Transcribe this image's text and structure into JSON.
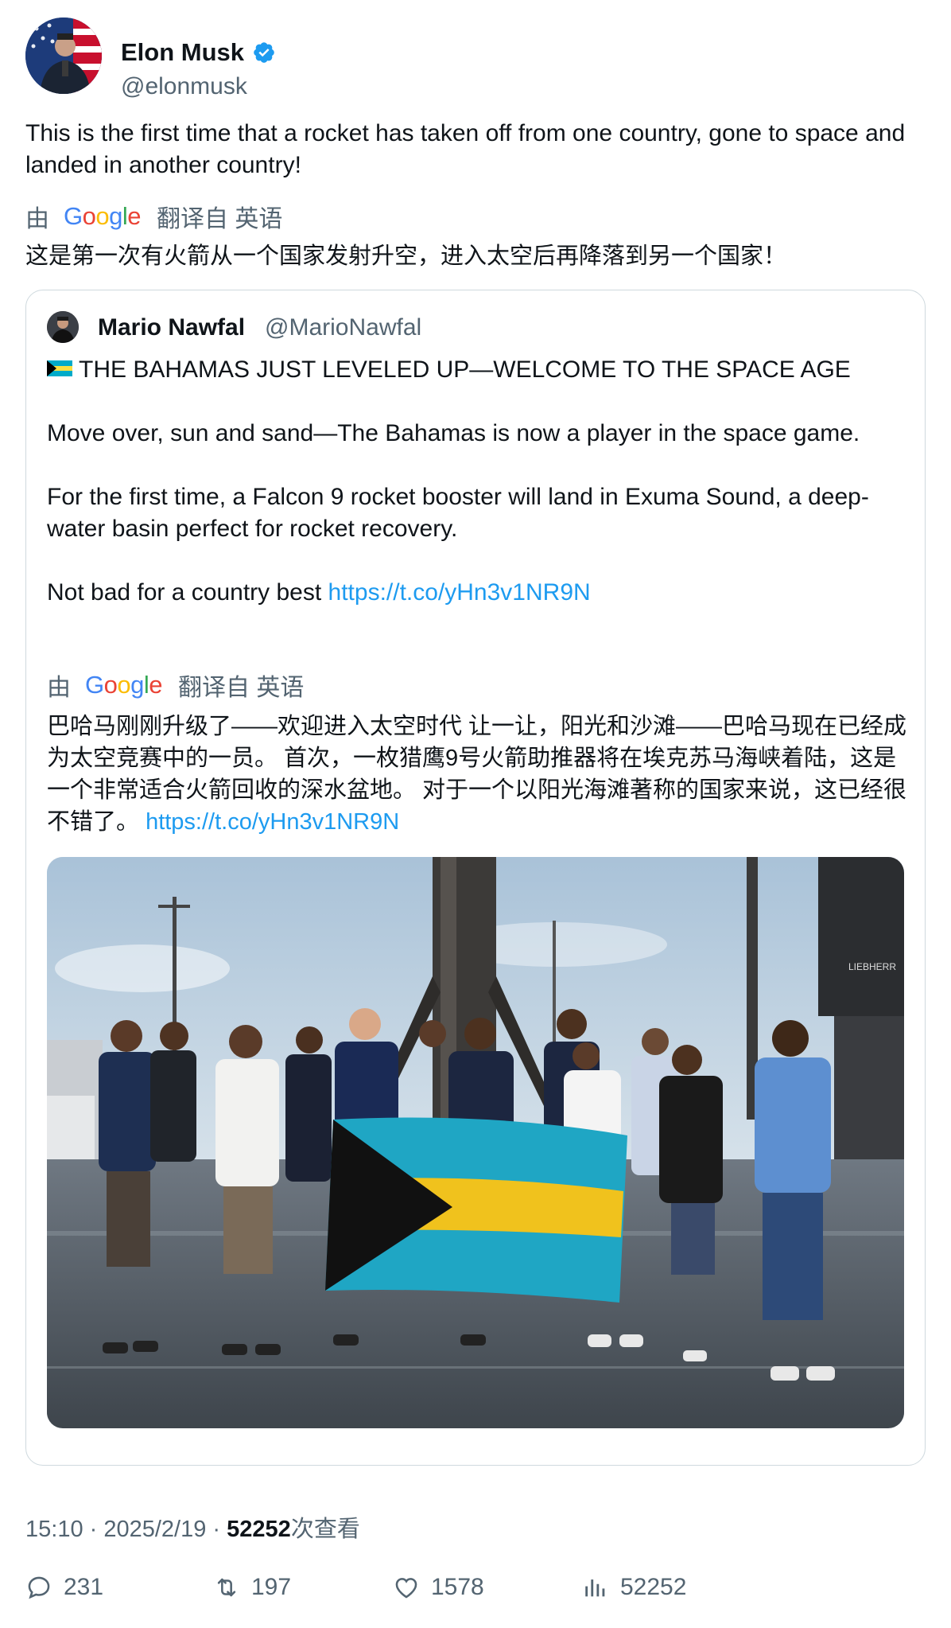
{
  "author": {
    "name": "Elon Musk",
    "handle": "@elonmusk",
    "verified": true,
    "avatar_icon": "avatar-flag-background"
  },
  "tweet": {
    "text": "This is the first time that a rocket has taken off from one country, gone to space and landed in another country!",
    "translation": {
      "by": "由",
      "provider": "Google",
      "label": "翻译自 英语",
      "text": "这是第一次有火箭从一个国家发射升空，进入太空后再降落到另一个国家！"
    }
  },
  "quote": {
    "name": "Mario Nawfal",
    "handle": "@MarioNawfal",
    "paragraphs": [
      "THE BAHAMAS JUST LEVELED UP—WELCOME TO THE SPACE AGE",
      "",
      "Move over, sun and sand—The Bahamas is now a player in the space game.",
      "",
      " For the first time, a Falcon 9 rocket booster will land in Exuma Sound, a deep-water basin perfect for rocket recovery.",
      "",
      "Not bad for a country best "
    ],
    "link": "https://t.co/yHn3v1NR9N",
    "translation": {
      "by": "由",
      "provider": "Google",
      "label": "翻译自 英语",
      "text": "巴哈马刚刚升级了——欢迎进入太空时代 让一让，阳光和沙滩——巴哈马现在已经成为太空竞赛中的一员。 首次，一枚猎鹰9号火箭助推器将在埃克苏马海峡着陆，这是一个非常适合火箭回收的深水盆地。 对于一个以阳光海滩著称的国家来说，这已经很不错了。 ",
      "link": "https://t.co/yHn3v1NR9N"
    },
    "photo_icon": "group-photo-bahamas-flag"
  },
  "meta": {
    "time": "15:10",
    "sep": " · ",
    "date": "2025/2/19",
    "views": "52252",
    "views_label": "次查看"
  },
  "actions": {
    "replies": "231",
    "retweets": "197",
    "likes": "1578",
    "views": "52252"
  },
  "colors": {
    "link": "#1d9bf0",
    "secondary_text": "#536471",
    "border": "#cfd9de",
    "verified": "#1d9bf0"
  }
}
